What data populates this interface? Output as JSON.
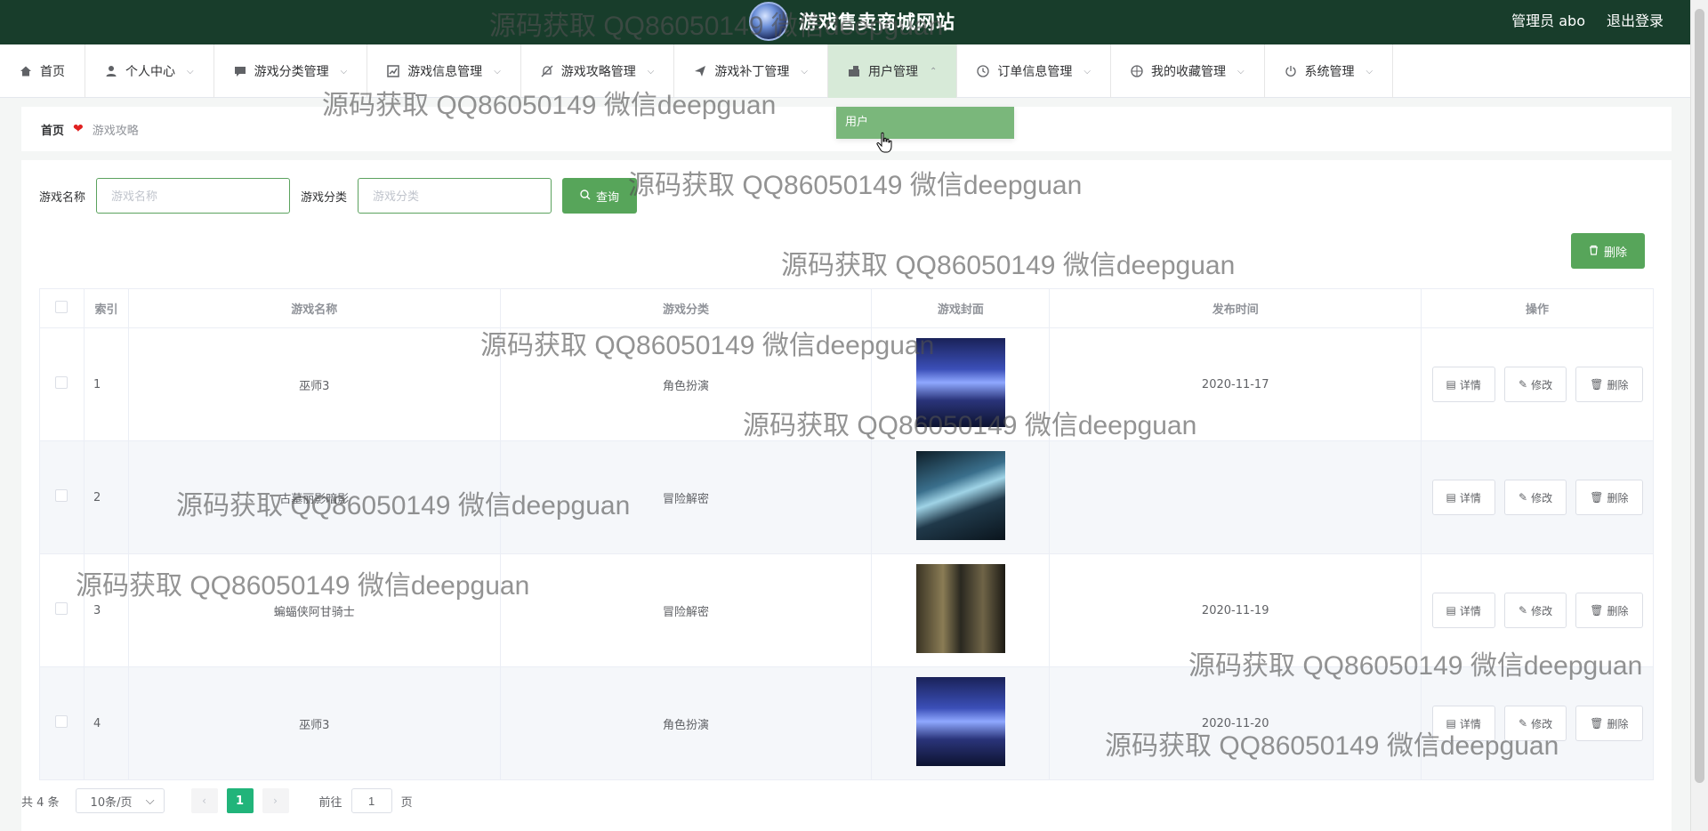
{
  "header": {
    "site_title": "游戏售卖商城网站",
    "admin_label": "管理员 abo",
    "logout_label": "退出登录"
  },
  "nav": {
    "items": [
      {
        "label": "首页",
        "icon": "home-icon"
      },
      {
        "label": "个人中心",
        "icon": "user-icon"
      },
      {
        "label": "游戏分类管理",
        "icon": "chat-icon"
      },
      {
        "label": "游戏信息管理",
        "icon": "chart-icon"
      },
      {
        "label": "游戏攻略管理",
        "icon": "bell-off-icon"
      },
      {
        "label": "游戏补丁管理",
        "icon": "send-icon"
      },
      {
        "label": "用户管理",
        "icon": "shop-icon"
      },
      {
        "label": "订单信息管理",
        "icon": "clock-icon"
      },
      {
        "label": "我的收藏管理",
        "icon": "basketball-icon"
      },
      {
        "label": "系统管理",
        "icon": "power-icon"
      }
    ],
    "dropdown_item": "用户"
  },
  "breadcrumb": {
    "home": "首页",
    "current": "游戏攻略"
  },
  "search": {
    "name_label": "游戏名称",
    "name_placeholder": "游戏名称",
    "category_label": "游戏分类",
    "category_placeholder": "游戏分类",
    "query_button": "查询"
  },
  "toolbar": {
    "delete_label": "删除"
  },
  "table": {
    "headers": [
      "索引",
      "游戏名称",
      "游戏分类",
      "游戏封面",
      "发布时间",
      "操作"
    ],
    "rows": [
      {
        "index": "1",
        "name": "巫师3",
        "category": "角色扮演",
        "date": "2020-11-17"
      },
      {
        "index": "2",
        "name": "古墓丽影暗影",
        "category": "冒险解密",
        "date": ""
      },
      {
        "index": "3",
        "name": "蝙蝠侠阿甘骑士",
        "category": "冒险解密",
        "date": "2020-11-19"
      },
      {
        "index": "4",
        "name": "巫师3",
        "category": "角色扮演",
        "date": "2020-11-20"
      }
    ],
    "actions": {
      "detail": "详情",
      "edit": "修改",
      "delete": "删除"
    }
  },
  "pagination": {
    "total": "共 4 条",
    "page_size": "10条/页",
    "current_page": "1",
    "goto_prefix": "前往",
    "goto_value": "1",
    "goto_suffix": "页"
  },
  "watermark": {
    "text": "源码获取 QQ86050149 微信deepguan"
  },
  "colors": {
    "header_bg": "#183d2b",
    "accent_green": "#57a55a",
    "active_page": "#21b47a",
    "dropdown_bg": "#7ab77b"
  }
}
